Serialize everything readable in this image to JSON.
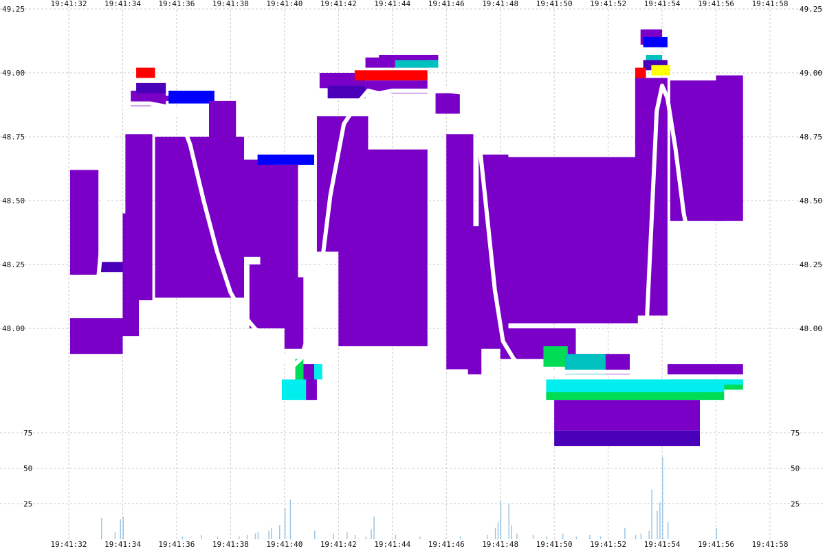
{
  "chart_data": [
    {
      "type": "heatmap",
      "description_scope": "order book depth heatmap with price overlay",
      "x_time_ticks": [
        "19:41:32",
        "19:41:34",
        "19:41:36",
        "19:41:38",
        "19:41:40",
        "19:41:42",
        "19:41:44",
        "19:41:46",
        "19:41:48",
        "19:41:50",
        "19:41:52",
        "19:41:54",
        "19:41:56",
        "19:41:58"
      ],
      "y_ticks": [
        "48.00",
        "48.25",
        "48.50",
        "48.75",
        "49.00",
        "49.25"
      ],
      "ylim": [
        47.82,
        49.25
      ],
      "grid": true,
      "colors": {
        "depth_main": "#7A00C8",
        "depth_dark": "#4A00B8",
        "blue": "#0000FF",
        "red": "#FF0000",
        "yellow": "#FFFF00",
        "green": "#00DD55",
        "cyan": "#00EEEE",
        "teal": "#00C0C0",
        "price_line": "#FFFFFF"
      },
      "price_line": {
        "name": "",
        "x": [
          "19:41:32.4",
          "19:41:33.1",
          "19:41:33.4",
          "19:41:33.8",
          "19:41:34.2",
          "19:41:35.0",
          "19:41:36.0",
          "19:41:36.5",
          "19:41:37.0",
          "19:41:37.5",
          "19:41:38.0",
          "19:41:38.5",
          "19:41:38.9",
          "19:41:39.3",
          "19:41:39.7",
          "19:41:40.0",
          "19:41:40.3",
          "19:41:40.6",
          "19:41:40.9",
          "19:41:41.3",
          "19:41:41.7",
          "19:41:42.2",
          "19:41:42.7",
          "19:41:43.1",
          "19:41:43.5",
          "19:41:44.0",
          "19:41:45.0",
          "19:41:46.0",
          "19:41:46.8",
          "19:41:47.2",
          "19:41:47.5",
          "19:41:47.8",
          "19:41:48.1",
          "19:41:48.5",
          "19:41:49.0",
          "19:41:50.0",
          "19:41:51.0",
          "19:41:52.0",
          "19:41:53.0",
          "19:41:53.4",
          "19:41:53.6",
          "19:41:53.8",
          "19:41:54.0",
          "19:41:54.2",
          "19:41:54.5",
          "19:41:54.8",
          "19:41:55.0"
        ],
        "y": [
          48.15,
          48.2,
          48.55,
          48.88,
          48.88,
          48.88,
          48.86,
          48.72,
          48.5,
          48.3,
          48.14,
          48.05,
          48.0,
          47.96,
          47.92,
          47.88,
          47.85,
          47.88,
          47.98,
          48.18,
          48.52,
          48.8,
          48.88,
          48.93,
          48.92,
          48.93,
          48.93,
          48.93,
          48.92,
          48.75,
          48.45,
          48.15,
          47.95,
          47.88,
          47.83,
          47.83,
          47.83,
          47.83,
          47.83,
          47.95,
          48.4,
          48.85,
          48.95,
          48.9,
          48.7,
          48.45,
          48.35
        ]
      }
    },
    {
      "type": "bar",
      "description_scope": "volume panel",
      "y_ticks": [
        "25",
        "50",
        "75"
      ],
      "ylim": [
        0,
        80
      ],
      "grid": true,
      "colors": {
        "bar": "#9CC6E4"
      },
      "x": [
        "19:41:33.2",
        "19:41:33.7",
        "19:41:33.9",
        "19:41:34.0",
        "19:41:36.2",
        "19:41:36.9",
        "19:41:37.5",
        "19:41:38.3",
        "19:41:38.6",
        "19:41:38.9",
        "19:41:39.0",
        "19:41:39.4",
        "19:41:39.5",
        "19:41:39.8",
        "19:41:40.0",
        "19:41:40.2",
        "19:41:41.1",
        "19:41:41.8",
        "19:41:42.3",
        "19:41:42.6",
        "19:41:43.0",
        "19:41:43.2",
        "19:41:43.3",
        "19:41:44.1",
        "19:41:45.0",
        "19:41:46.5",
        "19:41:47.5",
        "19:41:47.8",
        "19:41:47.9",
        "19:41:48.0",
        "19:41:48.3",
        "19:41:48.4",
        "19:41:48.6",
        "19:41:49.2",
        "19:41:49.7",
        "19:41:50.3",
        "19:41:50.8",
        "19:41:51.3",
        "19:41:51.7",
        "19:41:52.6",
        "19:41:53.0",
        "19:41:53.2",
        "19:41:53.5",
        "19:41:53.6",
        "19:41:53.8",
        "19:41:53.9",
        "19:41:54.0",
        "19:41:54.2",
        "19:41:56.0"
      ],
      "values": [
        15,
        5,
        14,
        16,
        2,
        3,
        2,
        2,
        3,
        4,
        5,
        6,
        8,
        10,
        22,
        28,
        6,
        4,
        5,
        3,
        2,
        7,
        16,
        3,
        2,
        2,
        3,
        8,
        12,
        27,
        25,
        10,
        4,
        3,
        2,
        4,
        2,
        3,
        2,
        8,
        3,
        4,
        6,
        35,
        20,
        26,
        58,
        12,
        8
      ]
    }
  ]
}
